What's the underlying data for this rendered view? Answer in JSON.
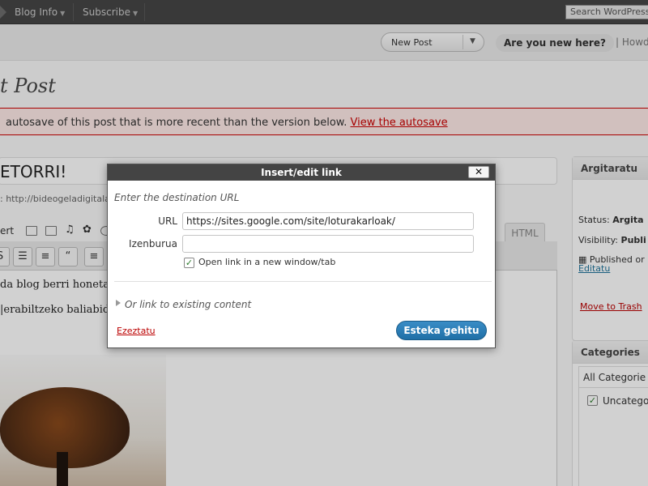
{
  "adminbar": {
    "blog_info": "Blog Info",
    "subscribe": "Subscribe",
    "search_placeholder": "Search WordPress"
  },
  "header": {
    "new_post": "New Post",
    "new_here": "Are you new here?",
    "howto": "| Howd"
  },
  "page": {
    "title": "t Post"
  },
  "notice": {
    "text": " autosave of this post that is more recent than the version below. ",
    "link": "View the autosave"
  },
  "editor": {
    "post_title": "ETORRI!",
    "permalink": ": http://bideogeladigitala",
    "insert_label": "ert",
    "html_tab": "HTML",
    "line1": "da blog berri honetako",
    "line2": "|erabiltzeko baliabide"
  },
  "sidebar": {
    "publish_head": "Argitaratu",
    "status_label": "Status:",
    "status_value": "Argita",
    "visibility_label": "Visibility:",
    "visibility_value": "Publi",
    "published_on": "Published or",
    "edit": "Editatu",
    "move_to_trash": "Move to Trash",
    "categories_head": "Categories",
    "all_categories": "All Categorie",
    "uncategorized": "Uncatego"
  },
  "dialog": {
    "title": "Insert/edit link",
    "close": "✕",
    "heading": "Enter the destination URL",
    "url_label": "URL",
    "url_value": "https://sites.google.com/site/loturakarloak/",
    "title_label": "Izenburua",
    "title_value": "",
    "new_window_label": "Open link in a new window/tab",
    "new_window_checked": true,
    "existing_content": "Or link to existing content",
    "cancel": "Ezeztatu",
    "submit": "Esteka gehitu"
  },
  "colors": {
    "adminbar": "#464646",
    "notice_border": "#cc0000",
    "submit_button": "#2271b1",
    "link_blue": "#21759b"
  }
}
